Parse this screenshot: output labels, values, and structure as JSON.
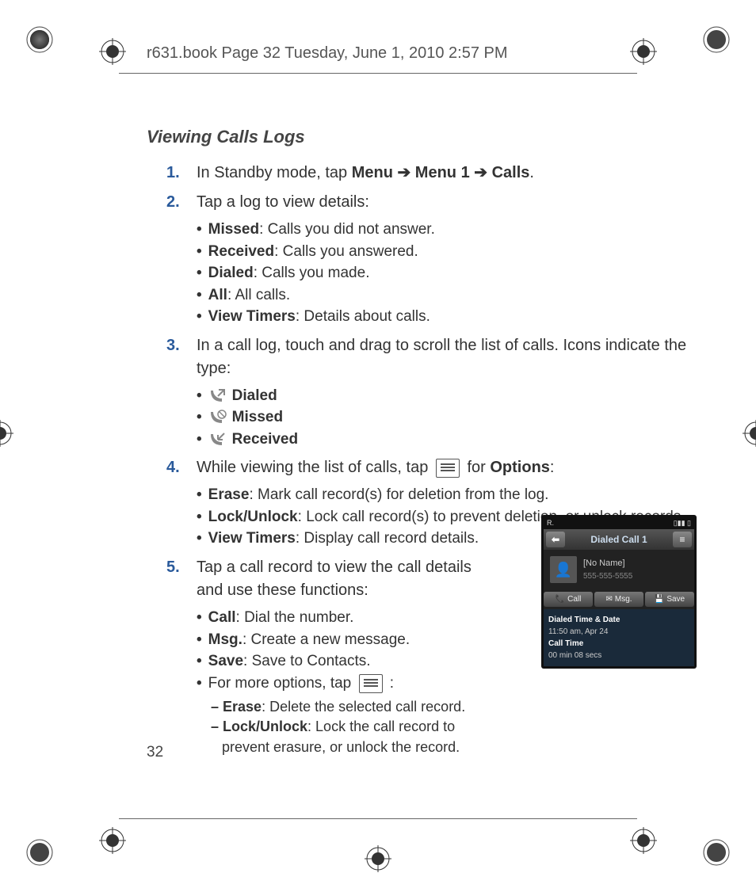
{
  "header": "r631.book  Page 32  Tuesday, June 1, 2010  2:57 PM",
  "page_number": "32",
  "section_title": "Viewing Calls Logs",
  "steps": {
    "s1": {
      "num": "1.",
      "prefix": "In Standby mode, tap ",
      "b1": "Menu",
      "b2": "Menu 1",
      "b3": "Calls",
      "suffix": "."
    },
    "s2": {
      "num": "2.",
      "text": "Tap a log to view details:",
      "items": {
        "i1b": "Missed",
        "i1t": ": Calls you did not answer.",
        "i2b": "Received",
        "i2t": ": Calls you answered.",
        "i3b": "Dialed",
        "i3t": ": Calls you made.",
        "i4b": "All",
        "i4t": ": All calls.",
        "i5b": "View Timers",
        "i5t": ": Details about calls."
      }
    },
    "s3": {
      "num": "3.",
      "text": "In a call log, touch and drag to scroll the list of calls. Icons indicate the type:",
      "icons": {
        "dialed": "Dialed",
        "missed": "Missed",
        "received": "Received"
      }
    },
    "s4": {
      "num": "4.",
      "prefix": "While viewing the list of calls, tap ",
      "mid": " for ",
      "opt": "Options",
      "suffix": ":",
      "items": {
        "i1b": "Erase",
        "i1t": ": Mark call record(s) for deletion from the log.",
        "i2b": "Lock/Unlock",
        "i2t": ": Lock call record(s) to prevent deletion, or unlock records.",
        "i3b": "View Timers",
        "i3t": ": Display call record details."
      }
    },
    "s5": {
      "num": "5.",
      "text": "Tap a call record to view the call details and use these functions:",
      "items": {
        "i1b": "Call",
        "i1t": ": Dial the number.",
        "i2b": "Msg.",
        "i2t": ": Create a new message.",
        "i3b": "Save",
        "i3t": ": Save to Contacts.",
        "i4t": "For more options, tap ",
        "i4s": " :"
      },
      "dash": {
        "d1b": "Erase",
        "d1t": ": Delete the selected call record.",
        "d2b": "Lock/Unlock",
        "d2t": ": Lock the call record to prevent erasure, or unlock the record."
      }
    }
  },
  "phone": {
    "status_left": "R.",
    "status_right": " ",
    "title": "Dialed Call 1",
    "contact_name": "[No Name]",
    "contact_num": "555-555-5555",
    "btn_call": "Call",
    "btn_msg": "Msg.",
    "btn_save": "Save",
    "det_lbl1": "Dialed Time & Date",
    "det_val1": "11:50 am, Apr 24",
    "det_lbl2": "Call Time",
    "det_val2": "00 min 08 secs"
  }
}
